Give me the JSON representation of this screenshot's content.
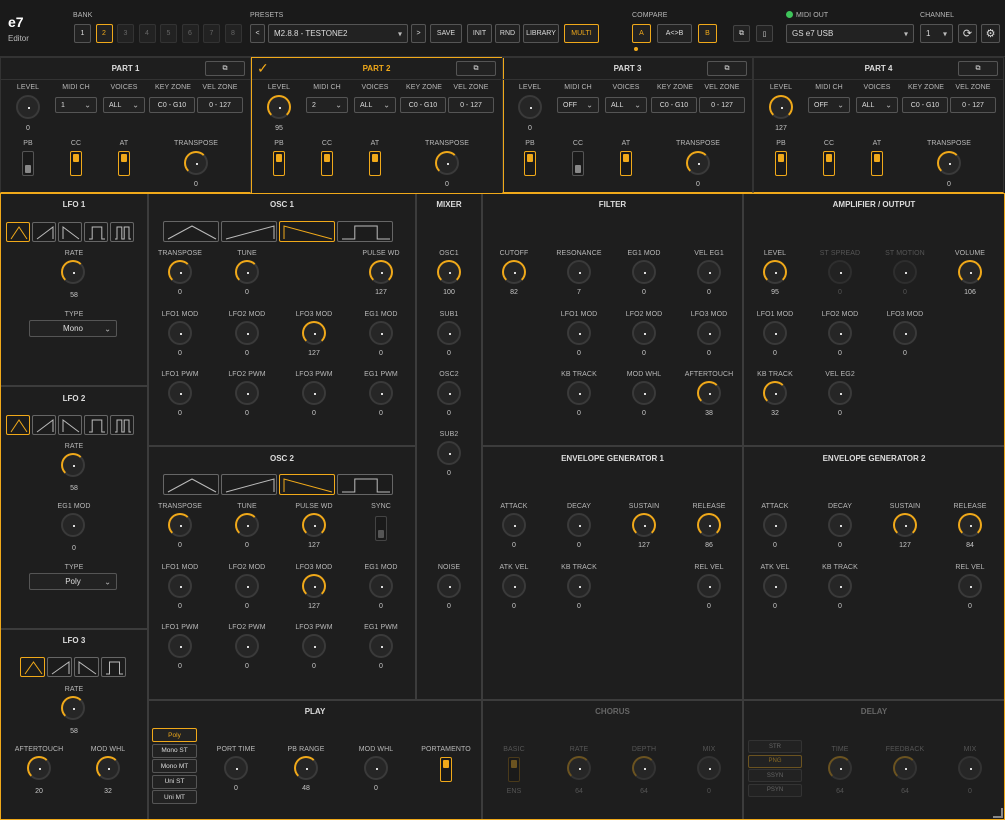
{
  "app": {
    "title": "e7",
    "subtitle": "Editor"
  },
  "colors": {
    "accent": "#f0a91a",
    "bg": "#1e1e1e",
    "led": "#3ec45a"
  },
  "bank": {
    "label": "BANK",
    "buttons": [
      "1",
      "2",
      "3",
      "4",
      "5",
      "6",
      "7",
      "8"
    ],
    "selected": "2"
  },
  "presets": {
    "label": "PRESETS",
    "prev": "<",
    "next": ">",
    "name": "M2.8.8 - TESTONE2",
    "save": "SAVE",
    "init": "INIT",
    "rnd": "RND",
    "library": "LIBRARY",
    "multi": "MULTI"
  },
  "compare": {
    "label": "COMPARE",
    "a": "A",
    "ab": "A<>B",
    "b": "B"
  },
  "midi": {
    "label": "MIDI OUT",
    "device": "GS e7 USB",
    "channel_label": "CHANNEL",
    "channel": "1"
  },
  "icons": {
    "copy": "copy-icon",
    "trash": "trash-icon",
    "sync": "sync-icon",
    "settings": "gear-icon",
    "check": "check-icon"
  },
  "parts_labels": {
    "level": "LEVEL",
    "midi_ch": "MIDI CH",
    "voices": "VOICES",
    "key_zone": "KEY ZONE",
    "vel_zone": "VEL ZONE",
    "pb": "PB",
    "cc": "CC",
    "at": "AT",
    "transpose": "TRANSPOSE"
  },
  "parts": [
    {
      "title": "PART 1",
      "level": "0",
      "midi_ch": "1",
      "voices": "ALL",
      "key_zone": "C0 - G10",
      "vel_zone": "0 - 127",
      "pb": false,
      "cc": true,
      "at": true,
      "transpose": "0",
      "selected": false
    },
    {
      "title": "PART 2",
      "level": "95",
      "midi_ch": "2",
      "voices": "ALL",
      "key_zone": "C0 - G10",
      "vel_zone": "0 - 127",
      "pb": true,
      "cc": true,
      "at": true,
      "transpose": "0",
      "selected": true
    },
    {
      "title": "PART 3",
      "level": "0",
      "midi_ch": "OFF",
      "voices": "ALL",
      "key_zone": "C0 - G10",
      "vel_zone": "0 - 127",
      "pb": true,
      "cc": false,
      "at": true,
      "transpose": "0",
      "selected": false
    },
    {
      "title": "PART 4",
      "level": "127",
      "midi_ch": "OFF",
      "voices": "ALL",
      "key_zone": "C0 - G10",
      "vel_zone": "0 - 127",
      "pb": true,
      "cc": true,
      "at": true,
      "transpose": "0",
      "selected": false
    }
  ],
  "lfo1": {
    "title": "LFO 1",
    "rate_label": "RATE",
    "rate": "58",
    "type_label": "TYPE",
    "type": "Mono"
  },
  "lfo2": {
    "title": "LFO 2",
    "rate_label": "RATE",
    "rate": "58",
    "eg1_label": "EG1 MOD",
    "eg1": "0",
    "type_label": "TYPE",
    "type": "Poly"
  },
  "lfo3": {
    "title": "LFO 3",
    "rate_label": "RATE",
    "rate": "58",
    "at_label": "AFTERTOUCH",
    "at": "20",
    "mw_label": "MOD WHL",
    "mw": "32"
  },
  "osc1": {
    "title": "OSC 1",
    "row1": [
      {
        "l": "TRANSPOSE",
        "v": "0",
        "k": "on"
      },
      {
        "l": "TUNE",
        "v": "0",
        "k": "on"
      },
      {
        "l": "PULSE WD",
        "v": "127",
        "k": "full"
      }
    ],
    "row2": [
      {
        "l": "LFO1 MOD",
        "v": "0"
      },
      {
        "l": "LFO2 MOD",
        "v": "0"
      },
      {
        "l": "LFO3 MOD",
        "v": "127",
        "k": "full"
      },
      {
        "l": "EG1 MOD",
        "v": "0"
      }
    ],
    "row3": [
      {
        "l": "LFO1 PWM",
        "v": "0"
      },
      {
        "l": "LFO2 PWM",
        "v": "0"
      },
      {
        "l": "LFO3 PWM",
        "v": "0"
      },
      {
        "l": "EG1 PWM",
        "v": "0"
      }
    ]
  },
  "osc2": {
    "title": "OSC 2",
    "row1": [
      {
        "l": "TRANSPOSE",
        "v": "0",
        "k": "on"
      },
      {
        "l": "TUNE",
        "v": "0",
        "k": "on"
      },
      {
        "l": "PULSE WD",
        "v": "127",
        "k": "full"
      }
    ],
    "sync": "SYNC",
    "row2": [
      {
        "l": "LFO1 MOD",
        "v": "0"
      },
      {
        "l": "LFO2 MOD",
        "v": "0"
      },
      {
        "l": "LFO3 MOD",
        "v": "127",
        "k": "full"
      },
      {
        "l": "EG1 MOD",
        "v": "0"
      }
    ],
    "row3": [
      {
        "l": "LFO1 PWM",
        "v": "0"
      },
      {
        "l": "LFO2 PWM",
        "v": "0"
      },
      {
        "l": "LFO3 PWM",
        "v": "0"
      },
      {
        "l": "EG1 PWM",
        "v": "0"
      }
    ]
  },
  "mixer": {
    "title": "MIXER",
    "items": [
      {
        "l": "OSC1",
        "v": "100",
        "k": "full"
      },
      {
        "l": "SUB1",
        "v": "0"
      },
      {
        "l": "OSC2",
        "v": "0"
      },
      {
        "l": "SUB2",
        "v": "0"
      },
      {
        "l": "NOISE",
        "v": "0"
      }
    ]
  },
  "filter": {
    "title": "FILTER",
    "row1": [
      {
        "l": "CUTOFF",
        "v": "82",
        "k": "full"
      },
      {
        "l": "RESONANCE",
        "v": "7"
      },
      {
        "l": "EG1 MOD",
        "v": "0"
      },
      {
        "l": "VEL EG1",
        "v": "0"
      }
    ],
    "row2": [
      {
        "l": "LFO1 MOD",
        "v": "0"
      },
      {
        "l": "LFO2 MOD",
        "v": "0"
      },
      {
        "l": "LFO3 MOD",
        "v": "0"
      }
    ],
    "row3": [
      {
        "l": "KB TRACK",
        "v": "0"
      },
      {
        "l": "MOD WHL",
        "v": "0"
      },
      {
        "l": "AFTERTOUCH",
        "v": "38",
        "k": "on"
      }
    ]
  },
  "amp": {
    "title": "AMPLIFIER / OUTPUT",
    "row1": [
      {
        "l": "LEVEL",
        "v": "95",
        "k": "full"
      },
      {
        "l": "ST SPREAD",
        "v": "0",
        "d": true
      },
      {
        "l": "ST MOTION",
        "v": "0",
        "d": true
      },
      {
        "l": "VOLUME",
        "v": "106",
        "k": "full"
      }
    ],
    "row2": [
      {
        "l": "LFO1 MOD",
        "v": "0"
      },
      {
        "l": "LFO2 MOD",
        "v": "0"
      },
      {
        "l": "LFO3 MOD",
        "v": "0"
      }
    ],
    "row3": [
      {
        "l": "KB TRACK",
        "v": "32",
        "k": "on"
      },
      {
        "l": "VEL EG2",
        "v": "0"
      }
    ]
  },
  "eg1": {
    "title": "ENVELOPE GENERATOR 1",
    "row1": [
      {
        "l": "ATTACK",
        "v": "0"
      },
      {
        "l": "DECAY",
        "v": "0"
      },
      {
        "l": "SUSTAIN",
        "v": "127",
        "k": "full"
      },
      {
        "l": "RELEASE",
        "v": "86",
        "k": "full"
      }
    ],
    "row2": [
      {
        "l": "ATK VEL",
        "v": "0"
      },
      {
        "l": "KB TRACK",
        "v": "0"
      },
      {
        "l": "REL VEL",
        "v": "0"
      }
    ]
  },
  "eg2": {
    "title": "ENVELOPE GENERATOR 2",
    "row1": [
      {
        "l": "ATTACK",
        "v": "0"
      },
      {
        "l": "DECAY",
        "v": "0"
      },
      {
        "l": "SUSTAIN",
        "v": "127",
        "k": "full"
      },
      {
        "l": "RELEASE",
        "v": "84",
        "k": "full"
      }
    ],
    "row2": [
      {
        "l": "ATK VEL",
        "v": "0"
      },
      {
        "l": "KB TRACK",
        "v": "0"
      },
      {
        "l": "REL VEL",
        "v": "0"
      }
    ]
  },
  "play": {
    "title": "PLAY",
    "modes": [
      "Poly",
      "Mono ST",
      "Mono MT",
      "Uni ST",
      "Uni MT"
    ],
    "selected": "Poly",
    "knobs": [
      {
        "l": "PORT TIME",
        "v": "0"
      },
      {
        "l": "PB RANGE",
        "v": "48",
        "k": "on"
      },
      {
        "l": "MOD WHL",
        "v": "0"
      }
    ],
    "portamento": "PORTAMENTO"
  },
  "chorus": {
    "title": "CHORUS",
    "basic": "BASIC",
    "ens": "ENS",
    "knobs": [
      {
        "l": "RATE",
        "v": "64"
      },
      {
        "l": "DEPTH",
        "v": "64"
      },
      {
        "l": "MIX",
        "v": "0"
      }
    ]
  },
  "delay": {
    "title": "DELAY",
    "modes": [
      "STR",
      "PNG",
      "SSYN",
      "PSYN"
    ],
    "selected": "PNG",
    "knobs": [
      {
        "l": "TIME",
        "v": "64"
      },
      {
        "l": "FEEDBACK",
        "v": "64"
      },
      {
        "l": "MIX",
        "v": "0"
      }
    ]
  }
}
